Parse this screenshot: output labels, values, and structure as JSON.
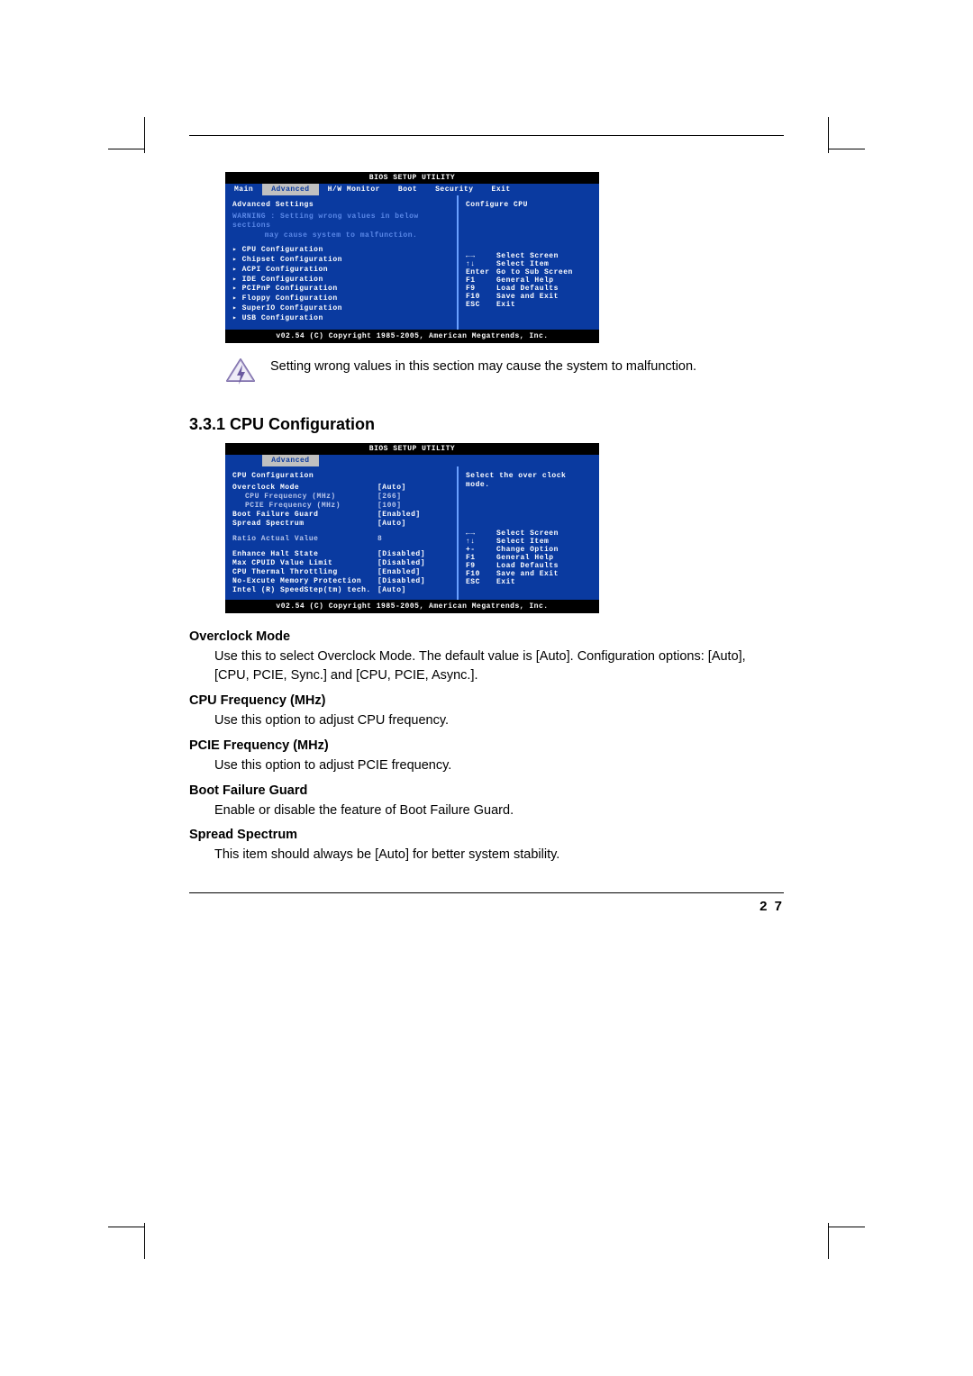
{
  "page_number": "2 7",
  "note_text": "Setting wrong values in this section may cause the system to malfunction.",
  "section_heading": "3.3.1 CPU Configuration",
  "bios1": {
    "title": "BIOS SETUP UTILITY",
    "tabs": {
      "main": "Main",
      "advanced": "Advanced",
      "hw": "H/W Monitor",
      "boot": "Boot",
      "security": "Security",
      "exit": "Exit"
    },
    "left_header": "Advanced Settings",
    "warning_l1": "WARNING : Setting wrong values in below sections",
    "warning_l2": "may cause system to malfunction.",
    "menu": {
      "cpu": "CPU Configuration",
      "chipset": "Chipset Configuration",
      "acpi": "ACPI Configuration",
      "ide": "IDE Configuration",
      "pcipnp": "PCIPnP Configuration",
      "floppy": "Floppy Configuration",
      "superio": "SuperIO Configuration",
      "usb": "USB Configuration"
    },
    "help_title": "Configure CPU",
    "keys": {
      "lr": {
        "k": "←→",
        "d": "Select Screen"
      },
      "ud": {
        "k": "↑↓",
        "d": "Select Item"
      },
      "enter": {
        "k": "Enter",
        "d": "Go to Sub Screen"
      },
      "f1": {
        "k": "F1",
        "d": "General Help"
      },
      "f9": {
        "k": "F9",
        "d": "Load Defaults"
      },
      "f10": {
        "k": "F10",
        "d": "Save and Exit"
      },
      "esc": {
        "k": "ESC",
        "d": "Exit"
      }
    },
    "footer": "v02.54 (C) Copyright 1985-2005, American Megatrends, Inc."
  },
  "bios2": {
    "title": "BIOS SETUP UTILITY",
    "tab_advanced": "Advanced",
    "left_header": "CPU Configuration",
    "rows": {
      "overclock": {
        "l": "Overclock Mode",
        "v": "[Auto]"
      },
      "cpufreq": {
        "l": "CPU Frequency (MHz)",
        "v": "[266]"
      },
      "pciefreq": {
        "l": "PCIE Frequency (MHz)",
        "v": "[100]"
      },
      "bootfail": {
        "l": "Boot Failure Guard",
        "v": "[Enabled]"
      },
      "spread": {
        "l": "Spread Spectrum",
        "v": "[Auto]"
      },
      "ratio": {
        "l": "Ratio Actual Value",
        "v": "8"
      },
      "ehs": {
        "l": "Enhance Halt State",
        "v": "[Disabled]"
      },
      "maxcpuid": {
        "l": "Max CPUID Value Limit",
        "v": "[Disabled]"
      },
      "thermal": {
        "l": "CPU Thermal Throttling",
        "v": "[Enabled]"
      },
      "noexec": {
        "l": "No-Excute Memory Protection",
        "v": "[Disabled]"
      },
      "speedstep": {
        "l": "Intel (R) SpeedStep(tm) tech.",
        "v": "[Auto]"
      }
    },
    "help_title_l1": "Select the over clock",
    "help_title_l2": "mode.",
    "keys": {
      "lr": {
        "k": "←→",
        "d": "Select Screen"
      },
      "ud": {
        "k": "↑↓",
        "d": "Select Item"
      },
      "pm": {
        "k": "+-",
        "d": "Change Option"
      },
      "f1": {
        "k": "F1",
        "d": "General Help"
      },
      "f9": {
        "k": "F9",
        "d": "Load Defaults"
      },
      "f10": {
        "k": "F10",
        "d": "Save and Exit"
      },
      "esc": {
        "k": "ESC",
        "d": "Exit"
      }
    },
    "footer": "v02.54 (C) Copyright 1985-2005, American Megatrends, Inc."
  },
  "desc": {
    "overclock": {
      "h": "Overclock Mode",
      "t": "Use this to select Overclock Mode. The default value is [Auto]. Configuration options: [Auto], [CPU, PCIE, Sync.] and [CPU, PCIE, Async.]."
    },
    "cpufreq": {
      "h": "CPU Frequency (MHz)",
      "t": "Use this option to adjust CPU frequency."
    },
    "pciefreq": {
      "h": "PCIE Frequency (MHz)",
      "t": "Use this option to adjust PCIE frequency."
    },
    "bootfail": {
      "h": "Boot Failure Guard",
      "t": "Enable or disable the feature of Boot Failure Guard."
    },
    "spread": {
      "h": "Spread Spectrum",
      "t": "This item should always be [Auto] for better system stability."
    }
  }
}
